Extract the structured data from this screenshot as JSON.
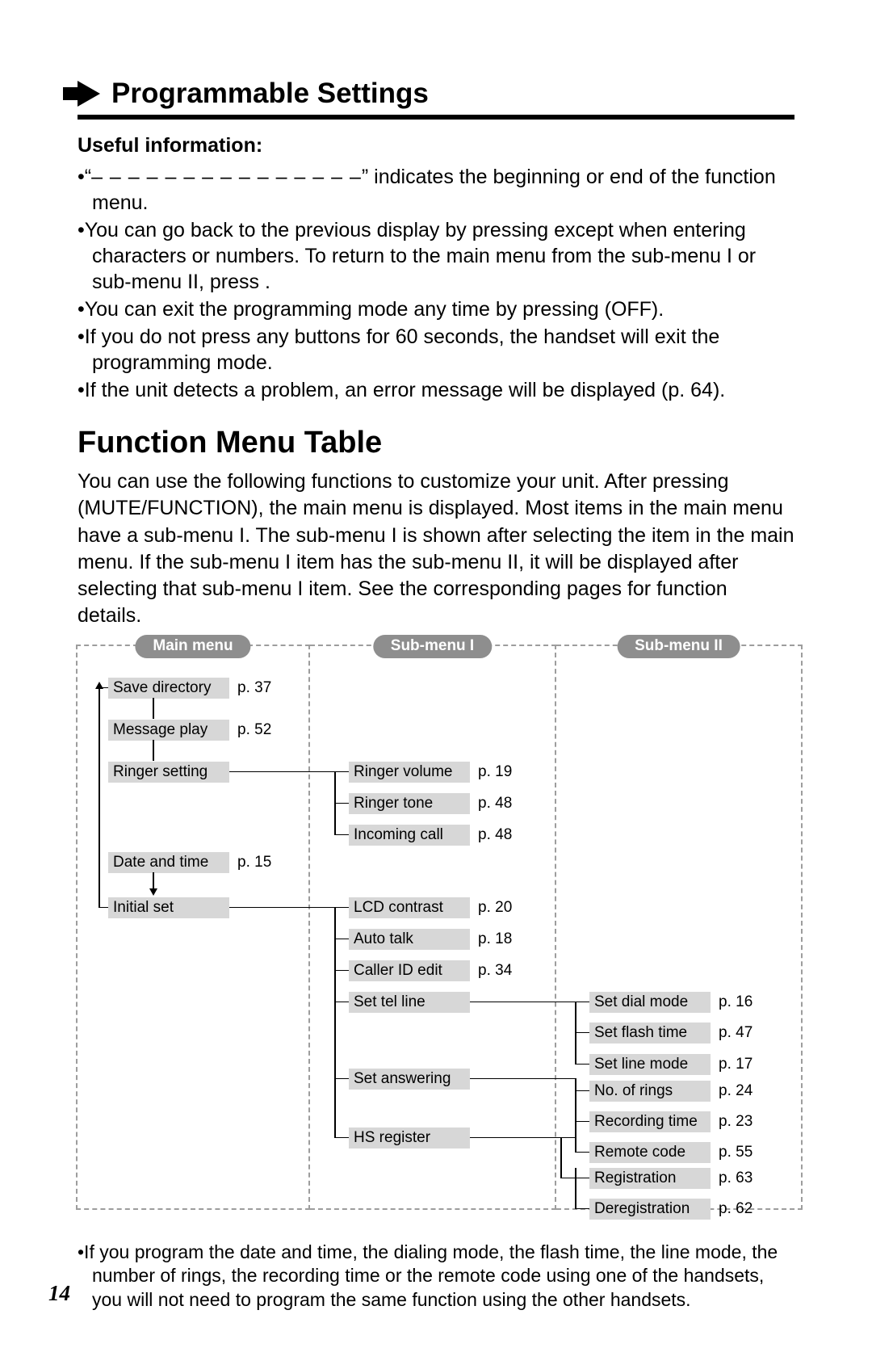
{
  "header": {
    "title": "Programmable Settings"
  },
  "useful": {
    "heading": "Useful information:",
    "b1a": "•“",
    "b1dashes": "– – – – – – – – – – – – – – –",
    "b1b": "” indicates the beginning or end of the function menu.",
    "b2": "•You can go back to the previous display by pressing        except when entering characters or numbers. To return to the main menu from the sub-menu I or sub-menu II, press        .",
    "b3": "•You can exit the programming mode any time by pressing (OFF).",
    "b4": "•If you do not press any buttons for 60 seconds, the handset will exit the programming mode.",
    "b5": "•If the unit detects a problem, an error message will be displayed (p. 64)."
  },
  "fmt": {
    "heading": "Function Menu Table",
    "intro": "You can use the following functions to customize your unit. After pressing (MUTE/FUNCTION), the main menu is displayed. Most items in the main menu have a sub-menu I. The sub-menu I is shown after selecting the item in the main menu. If the sub-menu I item has the sub-menu II, it will be displayed after selecting that sub-menu I item. See the corresponding pages for function details."
  },
  "pills": {
    "main": "Main menu",
    "sub1": "Sub-menu I",
    "sub2": "Sub-menu II"
  },
  "main_items": {
    "save_directory": {
      "label": "Save directory",
      "page": "p. 37"
    },
    "message_play": {
      "label": "Message play",
      "page": "p. 52"
    },
    "ringer_setting": {
      "label": "Ringer setting",
      "page": ""
    },
    "date_and_time": {
      "label": "Date and time",
      "page": "p. 15"
    },
    "initial_set": {
      "label": "Initial set",
      "page": ""
    }
  },
  "sub1_items": {
    "ringer_volume": {
      "label": "Ringer volume",
      "page": "p. 19"
    },
    "ringer_tone": {
      "label": "Ringer tone",
      "page": "p. 48"
    },
    "incoming_call": {
      "label": "Incoming call",
      "page": "p. 48"
    },
    "lcd_contrast": {
      "label": "LCD contrast",
      "page": "p. 20"
    },
    "auto_talk": {
      "label": "Auto talk",
      "page": "p. 18"
    },
    "caller_id": {
      "label": "Caller ID edit",
      "page": "p. 34"
    },
    "set_tel_line": {
      "label": "Set tel line",
      "page": ""
    },
    "set_answering": {
      "label": "Set answering",
      "page": ""
    },
    "hs_register": {
      "label": "HS register",
      "page": ""
    }
  },
  "sub2_items": {
    "set_dial_mode": {
      "label": "Set dial mode",
      "page": "p. 16"
    },
    "set_flash_time": {
      "label": "Set flash time",
      "page": "p. 47"
    },
    "set_line_mode": {
      "label": "Set line mode",
      "page": "p. 17"
    },
    "no_of_rings": {
      "label": "No. of rings",
      "page": "p. 24"
    },
    "recording_time": {
      "label": "Recording time",
      "page": "p. 23"
    },
    "remote_code": {
      "label": "Remote code",
      "page": "p. 55"
    },
    "registration": {
      "label": "Registration",
      "page": "p. 63"
    },
    "deregistration": {
      "label": "Deregistration",
      "page": "p. 62"
    }
  },
  "footnote": "•If you program the date and time, the dialing mode, the flash time, the line mode, the number of rings, the recording time or the remote code using one of the handsets, you will not need to program the same function using the other handsets.",
  "page_number": "14"
}
